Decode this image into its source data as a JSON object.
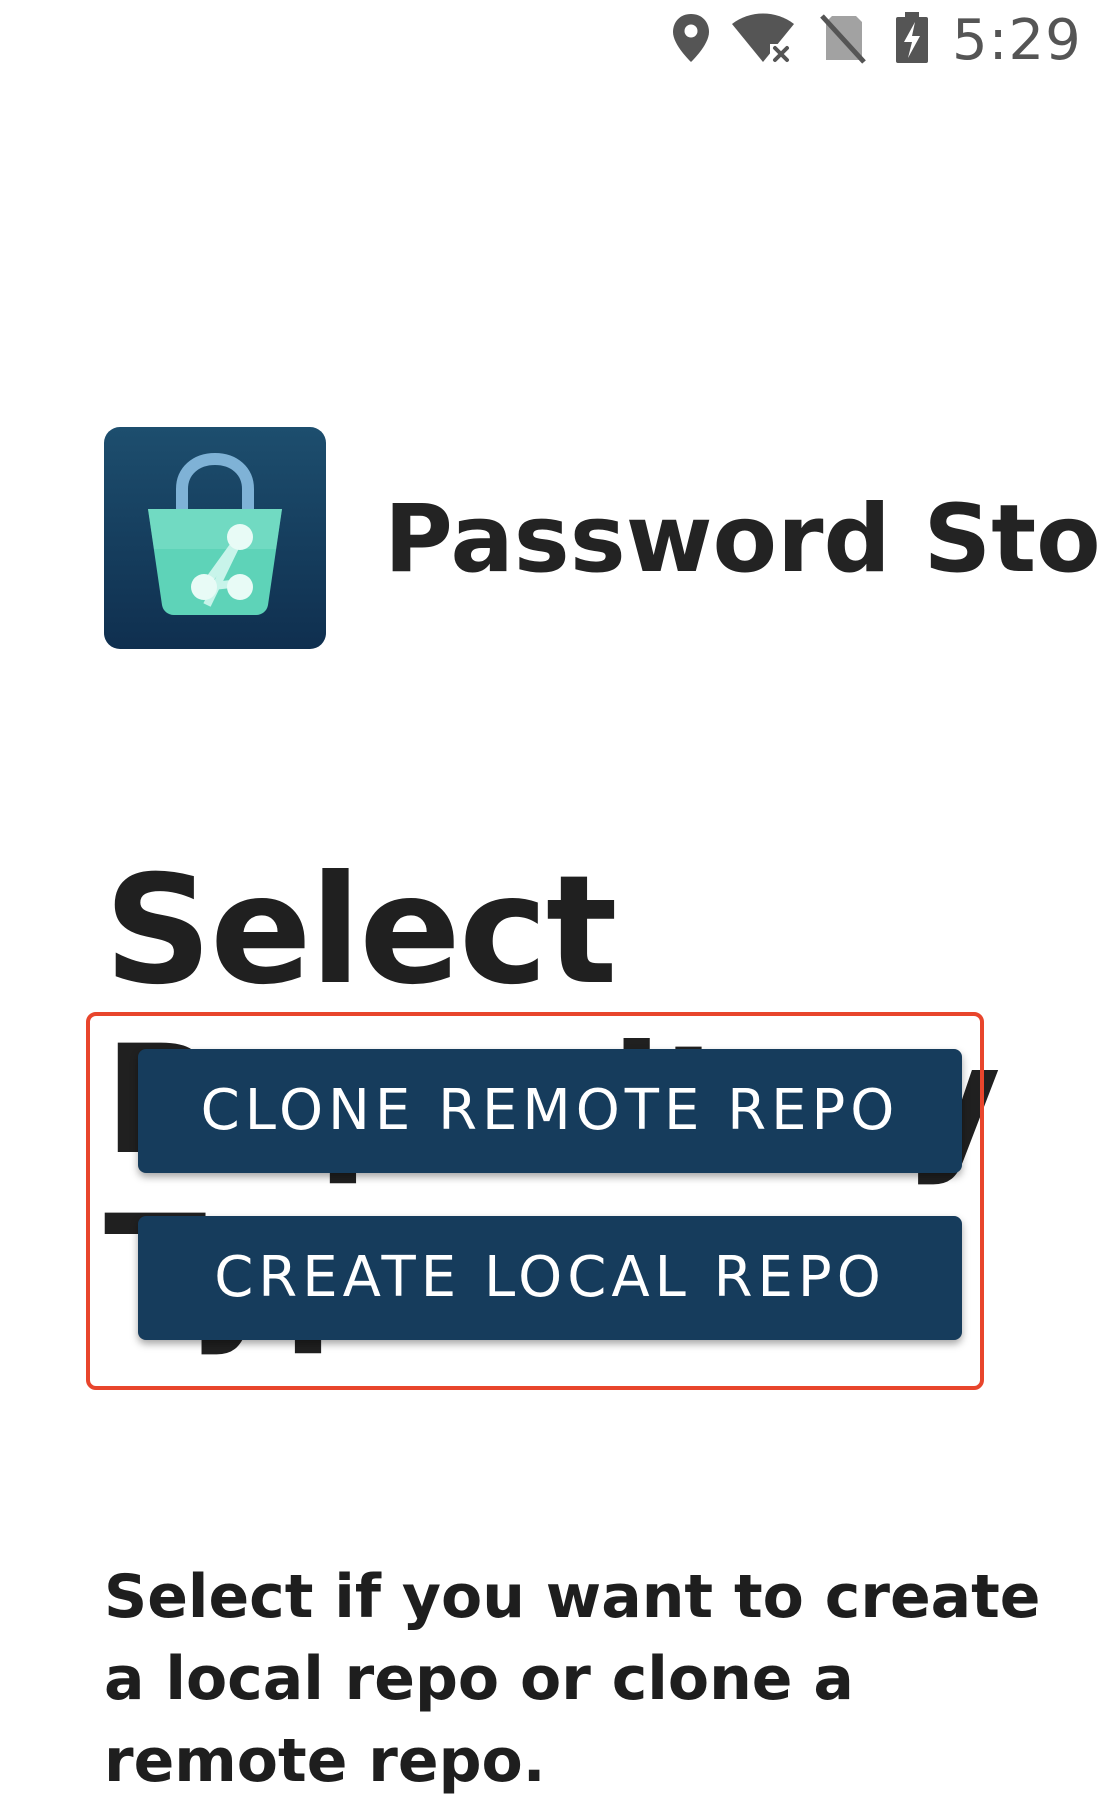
{
  "status_bar": {
    "time": "5:29",
    "icons": [
      "location-icon",
      "wifi-off-icon",
      "no-sim-icon",
      "battery-charging-icon"
    ]
  },
  "header": {
    "app_title": "Password Store",
    "logo_icon": "password-store-logo-icon"
  },
  "main": {
    "heading": "Select Repository Type",
    "actions": {
      "clone_remote_label": "CLONE REMOTE REPO",
      "create_local_label": "CREATE LOCAL REPO"
    },
    "description": "Select if you want to create a local repo or clone a remote repo."
  },
  "colors": {
    "button_background": "#163c5c",
    "button_text": "#ffffff",
    "highlight_border": "#e8452c",
    "logo_background": "#0f2f4f",
    "logo_bag": "#5ed3b8"
  }
}
